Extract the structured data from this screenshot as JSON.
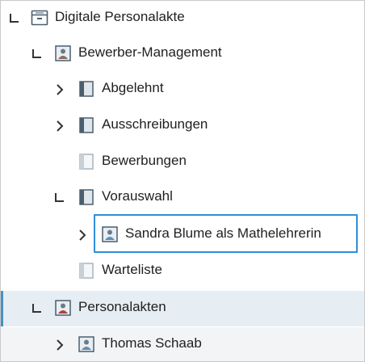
{
  "tree": {
    "root": {
      "label": "Digitale Personalakte",
      "icon": "archive-icon"
    },
    "bewerber": {
      "label": "Bewerber-Management",
      "icon": "person-folder-icon"
    },
    "abgelehnt": {
      "label": "Abgelehnt",
      "icon": "register-icon"
    },
    "ausschreibungen": {
      "label": "Ausschreibungen",
      "icon": "register-icon"
    },
    "bewerbungen": {
      "label": "Bewerbungen",
      "icon": "register-empty-icon"
    },
    "vorauswahl": {
      "label": "Vorauswahl",
      "icon": "register-icon"
    },
    "sandra": {
      "label": "Sandra Blume als Mathelehrerin",
      "icon": "person-file-icon"
    },
    "warteliste": {
      "label": "Warteliste",
      "icon": "register-empty-icon"
    },
    "personalakten": {
      "label": "Personalakten",
      "icon": "person-folder-icon"
    },
    "thomas": {
      "label": "Thomas Schaab",
      "icon": "person-file-icon"
    }
  },
  "colors": {
    "focus_border": "#2f8ed8",
    "selected_band": "#e6edf3",
    "accent_edge": "#4a90c2"
  }
}
